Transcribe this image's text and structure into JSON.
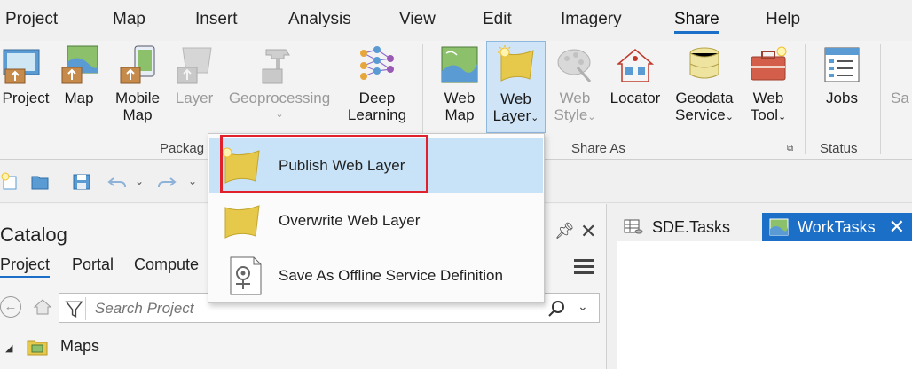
{
  "menubar": {
    "items": [
      "Project",
      "Map",
      "Insert",
      "Analysis",
      "View",
      "Edit",
      "Imagery",
      "Share",
      "Help"
    ],
    "active": "Share"
  },
  "ribbon": {
    "buttons": {
      "project": "Project",
      "map": "Map",
      "mobile_map": [
        "Mobile",
        "Map"
      ],
      "layer": "Layer",
      "geoprocessing": "Geoprocessing",
      "deep_learning": [
        "Deep",
        "Learning"
      ],
      "web_map": [
        "Web",
        "Map"
      ],
      "web_layer": [
        "Web",
        "Layer"
      ],
      "web_style": [
        "Web",
        "Style"
      ],
      "locator": "Locator",
      "geodata_service": [
        "Geodata",
        "Service"
      ],
      "web_tool": [
        "Web",
        "Tool"
      ],
      "jobs": "Jobs",
      "save_partial": "Sa"
    },
    "groups": {
      "package": "Packag",
      "share_as": "Share As",
      "status": "Status"
    }
  },
  "catalog": {
    "title": "Catalog",
    "tabs": [
      "Project",
      "Portal",
      "Compute"
    ],
    "search_placeholder": "Search Project",
    "tree": [
      {
        "label": "Maps"
      }
    ]
  },
  "doc_tabs": [
    {
      "label": "SDE.Tasks",
      "active": false
    },
    {
      "label": "WorkTasks",
      "active": true
    }
  ],
  "dropdown": {
    "items": [
      {
        "label": "Publish Web Layer",
        "highlighted": true
      },
      {
        "label": "Overwrite Web Layer",
        "highlighted": false
      },
      {
        "label": "Save As Offline Service Definition",
        "highlighted": false
      }
    ]
  },
  "colors": {
    "accent": "#1b6fc7",
    "highlight_border": "#e0202a",
    "hover_bg": "#c8e2f7",
    "selected_button_bg": "#cfe4f7"
  }
}
